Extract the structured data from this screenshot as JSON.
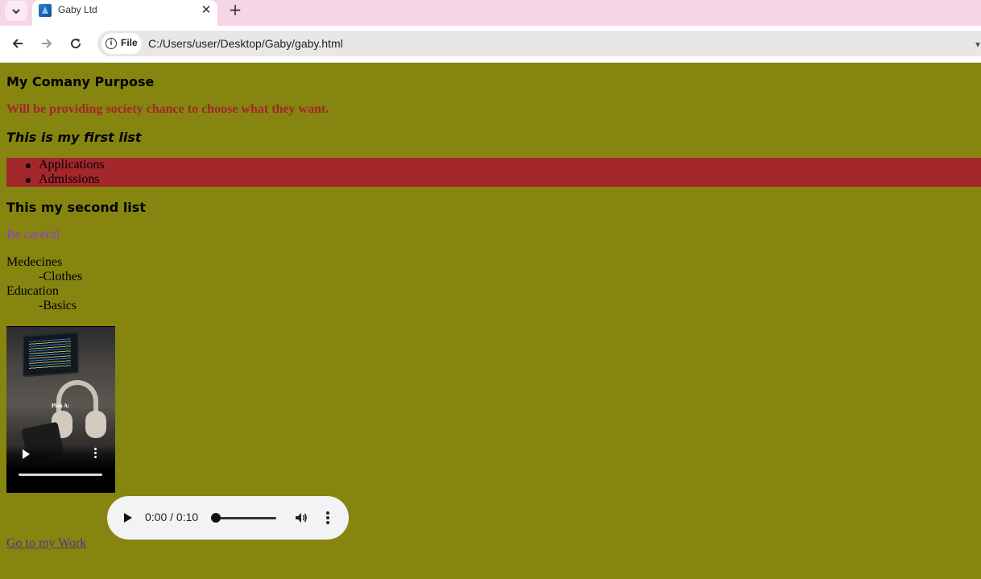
{
  "browser": {
    "tab_title": "Gaby Ltd",
    "url_scheme_label": "File",
    "url": "C:/Users/user/Desktop/Gaby/gaby.html"
  },
  "page": {
    "heading": "My Comany Purpose",
    "mission": "Will be providing society chance to choose what they want.",
    "first_list_heading": "This is my first list",
    "first_list": [
      "Applications",
      "Admissions"
    ],
    "second_list_heading": "This my second list",
    "warning": "Be careful",
    "definitions": [
      {
        "term": "Medecines",
        "detail": "-Clothes"
      },
      {
        "term": "Education",
        "detail": "-Basics"
      }
    ],
    "video_overlay_text": "Plan A:",
    "audio_time": "0:00 / 0:10",
    "link_text": "Go to my Work"
  },
  "colors": {
    "page_background": "#868510",
    "mission_text": "#a4262c",
    "list_background": "#a4272c",
    "warning_text": "#8d3be0",
    "link_text": "#5b2f86"
  }
}
